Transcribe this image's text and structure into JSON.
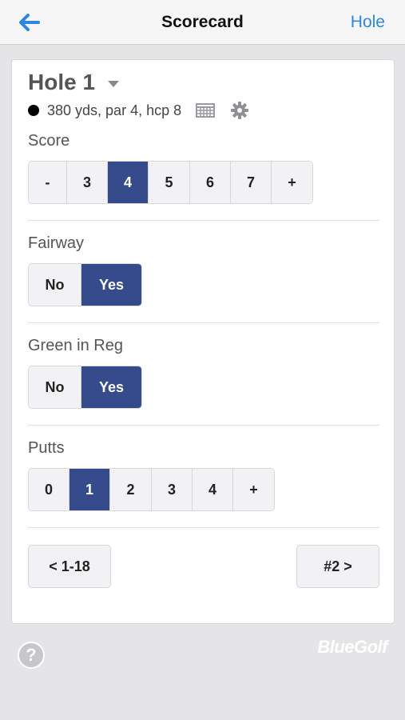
{
  "nav": {
    "title": "Scorecard",
    "right_label": "Hole"
  },
  "hole": {
    "title": "Hole 1",
    "info": "380 yds, par 4, hcp 8"
  },
  "score": {
    "label": "Score",
    "options": [
      "-",
      "3",
      "4",
      "5",
      "6",
      "7",
      "+"
    ],
    "selected": "4"
  },
  "fairway": {
    "label": "Fairway",
    "options": [
      "No",
      "Yes"
    ],
    "selected": "Yes"
  },
  "gir": {
    "label": "Green in Reg",
    "options": [
      "No",
      "Yes"
    ],
    "selected": "Yes"
  },
  "putts": {
    "label": "Putts",
    "options": [
      "0",
      "1",
      "2",
      "3",
      "4",
      "+"
    ],
    "selected": "1"
  },
  "footer_nav": {
    "prev_label": "< 1-18",
    "next_label": "#2 >"
  },
  "help_label": "?",
  "brand": "BlueGolf",
  "colors": {
    "accent": "#354b8c",
    "link": "#2b86e6"
  },
  "icons": {
    "back": "arrow-left-icon",
    "dropdown": "caret-down-icon",
    "tee": "dot-icon",
    "calendar": "calendar-icon",
    "settings": "gear-icon",
    "help": "question-icon"
  }
}
